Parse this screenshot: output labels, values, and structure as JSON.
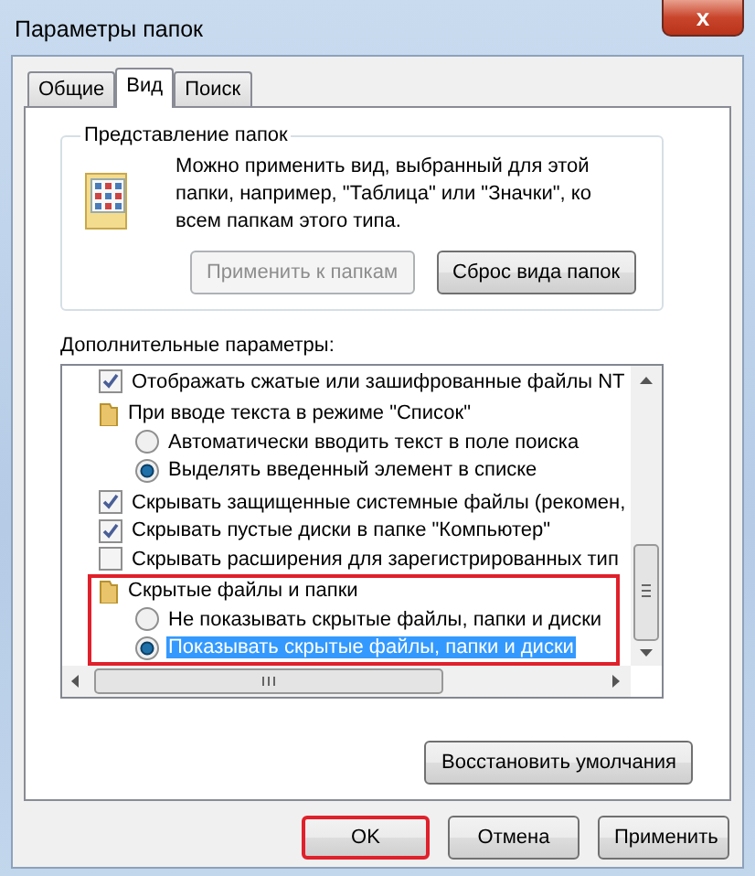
{
  "window": {
    "title": "Параметры папок",
    "close": "x"
  },
  "tabs": [
    {
      "label": "Общие",
      "selected": false
    },
    {
      "label": "Вид",
      "selected": true
    },
    {
      "label": "Поиск",
      "selected": false
    }
  ],
  "folder_views": {
    "title": "Представление папок",
    "description": "Можно применить вид, выбранный для этой папки, например, \"Таблица\" или \"Значки\", ко всем папкам этого типа.",
    "buttons": [
      {
        "label": "Применить к папкам",
        "disabled": true
      },
      {
        "label": "Сброс вида папок",
        "disabled": false
      }
    ]
  },
  "advanced": {
    "title": "Дополнительные параметры:",
    "items": [
      {
        "kind": "checkbox",
        "label": "Отображать сжатые или зашифрованные файлы NT",
        "checked": true,
        "selected": false
      },
      {
        "kind": "folder",
        "label": "При вводе текста в режиме \"Список\"",
        "selected": false,
        "highlighted": false,
        "children": [
          {
            "kind": "radio",
            "label": "Автоматически вводить текст в поле поиска",
            "checked": false,
            "selected": false
          },
          {
            "kind": "radio",
            "label": "Выделять введенный элемент в списке",
            "checked": true,
            "selected": false
          }
        ]
      },
      {
        "kind": "checkbox",
        "label": "Скрывать защищенные системные файлы (рекомен,",
        "checked": true,
        "selected": false
      },
      {
        "kind": "checkbox",
        "label": "Скрывать пустые диски в папке \"Компьютер\"",
        "checked": true,
        "selected": false
      },
      {
        "kind": "checkbox",
        "label": "Скрывать расширения для зарегистрированных тип",
        "checked": false,
        "selected": false
      },
      {
        "kind": "folder",
        "label": "Скрытые файлы и папки",
        "selected": false,
        "highlighted": true,
        "children": [
          {
            "kind": "radio",
            "label": "Не показывать скрытые файлы, папки и диски",
            "checked": false,
            "selected": false
          },
          {
            "kind": "radio",
            "label": "Показывать скрытые файлы, папки и диски",
            "checked": true,
            "selected": true
          }
        ]
      }
    ],
    "restore_button": "Восстановить умолчания"
  },
  "buttons": [
    {
      "label": "OK",
      "highlighted": true
    },
    {
      "label": "Отмена",
      "highlighted": false
    },
    {
      "label": "Применить",
      "highlighted": false
    }
  ]
}
